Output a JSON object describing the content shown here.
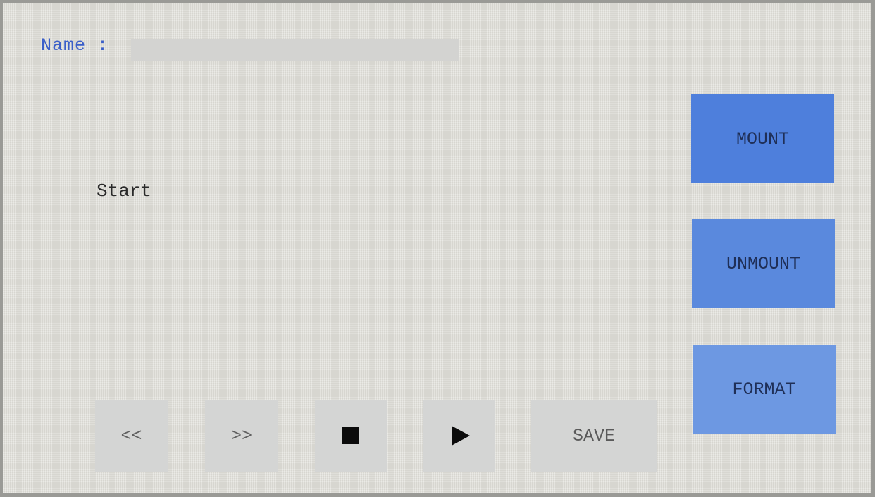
{
  "name_field": {
    "label": "Name :",
    "value": "",
    "placeholder": ""
  },
  "status": {
    "text": "Start"
  },
  "side_buttons": {
    "mount": "MOUNT",
    "unmount": "UNMOUNT",
    "format": "FORMAT"
  },
  "controls": {
    "rewind": "<<",
    "forward": ">>",
    "stop_icon": "stop-icon",
    "play_icon": "play-icon",
    "save": "SAVE"
  },
  "colors": {
    "label_blue": "#3b5fc9",
    "button_blue": "#4e7fdc",
    "control_gray": "#d4d5d4",
    "background": "#e3e2dc"
  }
}
